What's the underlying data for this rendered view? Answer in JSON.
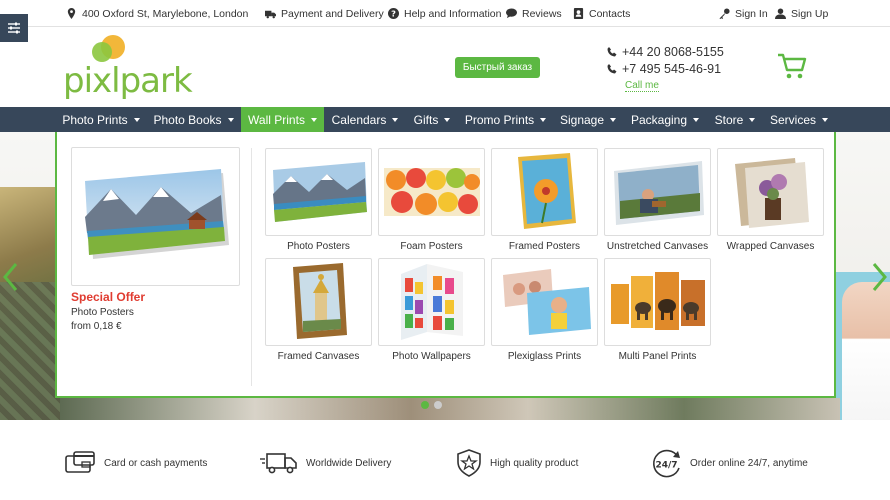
{
  "topbar": {
    "address": "400 Oxford St, Marylebone, London",
    "payment": "Payment and Delivery",
    "help": "Help and Information",
    "reviews": "Reviews",
    "contacts": "Contacts",
    "sign_in": "Sign In",
    "sign_up": "Sign Up"
  },
  "header": {
    "logo_text": "pixlpark",
    "quick_order": "Быстрый заказ",
    "phone_1": "+44 20 8068-5155",
    "phone_2": "+7 495 545-46-91",
    "call_me": "Call me"
  },
  "nav": {
    "items": [
      {
        "label": "Photo Prints"
      },
      {
        "label": "Photo Books"
      },
      {
        "label": "Wall Prints"
      },
      {
        "label": "Calendars"
      },
      {
        "label": "Gifts"
      },
      {
        "label": "Promo Prints"
      },
      {
        "label": "Signage"
      },
      {
        "label": "Packaging"
      },
      {
        "label": "Store"
      },
      {
        "label": "Services"
      }
    ],
    "active": "Wall Prints"
  },
  "mega": {
    "promo_title": "Special Offer",
    "promo_product": "Photo Posters",
    "promo_price": "from 0,18 €",
    "products": [
      {
        "label": "Photo Posters"
      },
      {
        "label": "Foam Posters"
      },
      {
        "label": "Framed Posters"
      },
      {
        "label": "Unstretched Canvases"
      },
      {
        "label": "Wrapped Canvases"
      },
      {
        "label": "Framed Canvases"
      },
      {
        "label": "Photo Wallpapers"
      },
      {
        "label": "Plexiglass Prints"
      },
      {
        "label": "Multi Panel Prints"
      }
    ]
  },
  "features": {
    "payments": "Card or cash payments",
    "delivery": "Worldwide Delivery",
    "quality": "High quality product",
    "online": "Order online 24/7, anytime",
    "online_badge": "24/7"
  },
  "colors": {
    "brand_green": "#5cb842",
    "nav_bg": "#37475a",
    "offer_red": "#e03c31"
  }
}
